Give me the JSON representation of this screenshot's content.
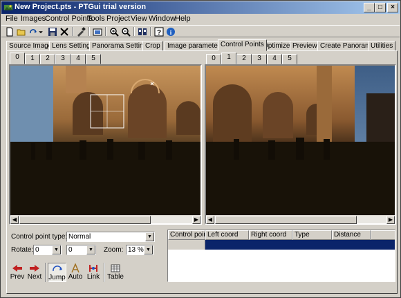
{
  "window": {
    "title": "New Project.pts - PTGui trial version",
    "controls": {
      "minimize": "_",
      "maximize": "□",
      "close": "×"
    }
  },
  "menu": [
    "File",
    "Images",
    "Control Points",
    "Tools",
    "Project",
    "View",
    "Window",
    "Help"
  ],
  "toolbar_icons": [
    "new-file-icon",
    "open-folder-icon",
    "redo-icon",
    "dropdown-arrow-icon",
    "save-icon",
    "delete-icon",
    "picker-icon",
    "panorama-editor-icon",
    "zoom-in-icon",
    "zoom-out-icon",
    "control-point-editor-icon",
    "help-icon",
    "info-icon"
  ],
  "main_tabs": [
    "Source Images",
    "Lens Settings",
    "Panorama Settings",
    "Crop",
    "Image parameters",
    "Control Points",
    "Optimizer",
    "Preview",
    "Create Panorama",
    "Utilities"
  ],
  "active_main_tab": "Control Points",
  "left_image_tabs": [
    "0",
    "1",
    "2",
    "3",
    "4",
    "5"
  ],
  "left_active": "0",
  "right_image_tabs": [
    "0",
    "1",
    "2",
    "3",
    "4",
    "5"
  ],
  "right_active": "1",
  "controls": {
    "cp_type_label": "Control point type:",
    "cp_type_value": "Normal",
    "rotate_label": "Rotate:",
    "rotate_left": "0",
    "rotate_right": "0",
    "zoom_label": "Zoom:",
    "zoom_value": "13 %"
  },
  "table": {
    "headers": [
      "Control point",
      "Left coord",
      "Right coord",
      "Type",
      "Distance"
    ],
    "selected_row_color": "#0a246a"
  },
  "buttons": {
    "prev": "Prev",
    "next": "Next",
    "jump": "Jump",
    "auto": "Auto",
    "link": "Link",
    "table": "Table"
  },
  "colors": {
    "title_start": "#0a246a",
    "title_end": "#a6caf0",
    "face": "#d4d0c8"
  }
}
